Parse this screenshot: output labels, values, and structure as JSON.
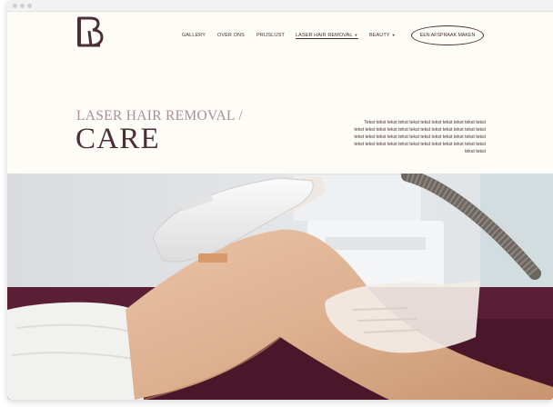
{
  "logo": {
    "letter": "B",
    "name": "logo-mark"
  },
  "nav": {
    "items": [
      {
        "label": "GALLERY",
        "dropdown": false,
        "active": false
      },
      {
        "label": "OVER ONS",
        "dropdown": false,
        "active": false
      },
      {
        "label": "PRIJSLIJST",
        "dropdown": false,
        "active": false
      },
      {
        "label": "LASER HAIR REMOVAL",
        "dropdown": true,
        "active": true
      },
      {
        "label": "BEAUTY",
        "dropdown": true,
        "active": false
      }
    ],
    "cta_label": "EEN AFSPRAAK MAKEN"
  },
  "hero": {
    "subtitle": "LASER HAIR REMOVAL /",
    "title": "CARE",
    "body": "Tekst tekst tekst tekst tekst tekst tekst tekst tekst tekst tekst tekst tekst tekst tekst tekst tekst tekst tekst tekst tekst tekst tekst tekst tekst tekst tekst tekst tekst tekst tekst tekst tekst tekst tekst tekst tekst tekst tekst tekst tekst tekst tekst tekst tekst tekst tekst tekst tekst"
  },
  "colors": {
    "brand": "#4a2f35",
    "accent": "#a8909a",
    "background": "#fdfcf7"
  },
  "icons": {
    "dropdown": "chevron-down-icon"
  },
  "image": {
    "subject": "hero-photo"
  }
}
